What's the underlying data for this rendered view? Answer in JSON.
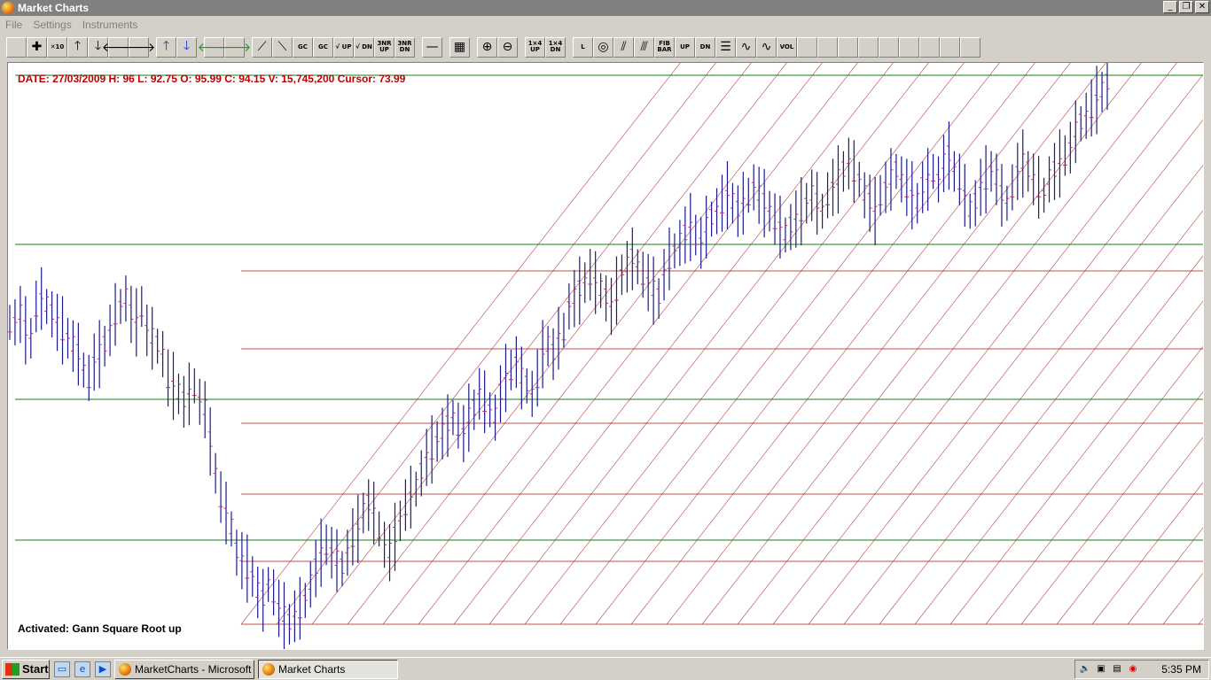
{
  "window": {
    "title": "Market Charts",
    "minimize_icon": "minimize-icon",
    "maximize_icon": "restore-icon",
    "close_icon": "close-icon",
    "min_glyph": "_",
    "max_glyph": "❐",
    "close_glyph": "✕"
  },
  "menu": [
    "File",
    "Settings",
    "Instruments"
  ],
  "toolbar": {
    "buttons": [
      {
        "name": "blank-tool-button",
        "label": "",
        "cls": ""
      },
      {
        "name": "crosshair-button",
        "label": "✚",
        "cls": ""
      },
      {
        "name": "zoom-x10-button",
        "label": "✕10",
        "cls": "small"
      },
      {
        "name": "arrow-up-button",
        "label": "🡑",
        "cls": ""
      },
      {
        "name": "arrow-down-button",
        "label": "🡓",
        "cls": ""
      },
      {
        "name": "arrow-left-button",
        "label": "🡐",
        "cls": ""
      },
      {
        "name": "arrow-right-button",
        "label": "🡒",
        "cls": ""
      },
      {
        "name": "blue-up-button",
        "label": "🡑",
        "cls": "blue sep"
      },
      {
        "name": "blue-down-button",
        "label": "🡓",
        "cls": "blue"
      },
      {
        "name": "green-left-button",
        "label": "🡐",
        "cls": "green sep"
      },
      {
        "name": "green-right-button",
        "label": "🡒",
        "cls": "green"
      },
      {
        "name": "trendline-up-button",
        "label": "⟋",
        "cls": "sep"
      },
      {
        "name": "trendline-down-button",
        "label": "⟍",
        "cls": ""
      },
      {
        "name": "gann-sc-button",
        "label": "GC",
        "cls": "small"
      },
      {
        "name": "gann-grid-button",
        "label": "GC",
        "cls": "small"
      },
      {
        "name": "gann-sqrt-up-button",
        "label": "√ UP",
        "cls": "small"
      },
      {
        "name": "gann-sqrt-dn-button",
        "label": "√ DN",
        "cls": "small"
      },
      {
        "name": "gann-3nr-up-button",
        "label": "3NR UP",
        "cls": "small"
      },
      {
        "name": "gann-3nr-dn-button",
        "label": "3NR DN",
        "cls": "small"
      },
      {
        "name": "horizontal-line-button",
        "label": "—",
        "cls": "sep"
      },
      {
        "name": "grid-button",
        "label": "▦",
        "cls": "sep"
      },
      {
        "name": "zoom-in-button",
        "label": "⊕",
        "cls": "sep"
      },
      {
        "name": "zoom-out-button",
        "label": "⊖",
        "cls": ""
      },
      {
        "name": "fourth-up-button",
        "label": "1×4 UP",
        "cls": "small sep"
      },
      {
        "name": "fourth-dn-button",
        "label": "1×4 DN",
        "cls": "small"
      },
      {
        "name": "label-tool-button",
        "label": "L",
        "cls": "small sep"
      },
      {
        "name": "circle-tool-button",
        "label": "◎",
        "cls": ""
      },
      {
        "name": "fan-tool-button",
        "label": "⫽",
        "cls": ""
      },
      {
        "name": "parallel-tool-button",
        "label": "⫻",
        "cls": ""
      },
      {
        "name": "fib-bar-button",
        "label": "FIB BAR",
        "cls": "small"
      },
      {
        "name": "box-up-button",
        "label": "UP",
        "cls": "small"
      },
      {
        "name": "box-dn-button",
        "label": "DN",
        "cls": "small"
      },
      {
        "name": "lines-button",
        "label": "☰",
        "cls": ""
      },
      {
        "name": "wave-up-button",
        "label": "∿",
        "cls": ""
      },
      {
        "name": "wave-dn-button",
        "label": "∿",
        "cls": ""
      },
      {
        "name": "volume-bar-button",
        "label": "VOL",
        "cls": "small"
      },
      {
        "name": "empty-button-1",
        "label": "",
        "cls": ""
      },
      {
        "name": "empty-button-2",
        "label": "",
        "cls": ""
      },
      {
        "name": "empty-button-3",
        "label": "",
        "cls": ""
      },
      {
        "name": "empty-button-4",
        "label": "",
        "cls": ""
      },
      {
        "name": "empty-button-5",
        "label": "",
        "cls": ""
      },
      {
        "name": "empty-button-6",
        "label": "",
        "cls": ""
      },
      {
        "name": "empty-button-7",
        "label": "",
        "cls": ""
      },
      {
        "name": "empty-button-8",
        "label": "",
        "cls": ""
      },
      {
        "name": "empty-button-9",
        "label": "",
        "cls": ""
      }
    ]
  },
  "chart": {
    "info": "DATE: 27/03/2009 H: 96 L: 92.75 O: 95.99 C: 94.15 V: 15,745,200 Cursor: 73.99",
    "status": "Activated: Gann Square Root up",
    "colors": {
      "bar": "#1a1a8c",
      "tick": "#c03060",
      "green_line": "#108010",
      "red_line": "#a01818",
      "diag_line": "#c06060"
    }
  },
  "chart_data": {
    "type": "ohlc",
    "title": "",
    "close_series_description": "",
    "values": [
      64,
      64,
      65,
      63,
      62,
      66,
      67,
      66,
      65,
      64,
      63,
      62,
      61,
      60,
      58,
      57,
      59,
      60,
      61,
      63,
      65,
      66,
      67,
      65,
      64,
      66,
      63,
      62,
      61,
      60,
      57,
      56,
      55,
      54,
      55,
      56,
      54,
      53,
      49,
      45,
      42,
      40,
      38,
      35,
      34,
      33,
      32,
      30,
      29,
      31,
      30,
      28,
      27,
      26,
      27,
      28,
      29,
      31,
      33,
      35,
      36,
      35,
      34,
      33,
      35,
      37,
      38,
      40,
      41,
      40,
      38,
      36,
      35,
      37,
      39,
      41,
      42,
      43,
      45,
      47,
      48,
      49,
      50,
      51,
      52,
      51,
      50,
      52,
      53,
      55,
      54,
      53,
      52,
      55,
      57,
      58,
      59,
      57,
      56,
      55,
      57,
      60,
      61,
      60,
      62,
      63,
      66,
      67,
      68,
      69,
      70,
      69,
      68,
      67,
      66,
      68,
      70,
      71,
      72,
      71,
      70,
      69,
      68,
      67,
      70,
      72,
      73,
      74,
      75,
      76,
      75,
      74,
      76,
      77,
      78,
      79,
      80,
      79,
      78,
      79,
      80,
      81,
      80,
      79,
      78,
      77,
      76,
      75,
      76,
      77,
      78,
      79,
      80,
      79,
      78,
      80,
      81,
      82,
      83,
      84,
      83,
      82,
      80,
      79,
      78,
      80,
      81,
      82,
      83,
      82,
      81,
      80,
      79,
      81,
      82,
      83,
      82,
      84,
      85,
      83,
      82,
      80,
      78,
      79,
      81,
      82,
      83,
      82,
      80,
      79,
      81,
      83,
      84,
      83,
      82,
      81,
      80,
      82,
      83,
      84,
      85,
      86,
      88,
      89,
      90,
      91,
      92,
      93,
      94
    ]
  },
  "taskbar": {
    "start_label": "Start",
    "tasks": [
      "MarketCharts - Microsoft ...",
      "Market Charts"
    ],
    "clock": "5:35 PM"
  }
}
